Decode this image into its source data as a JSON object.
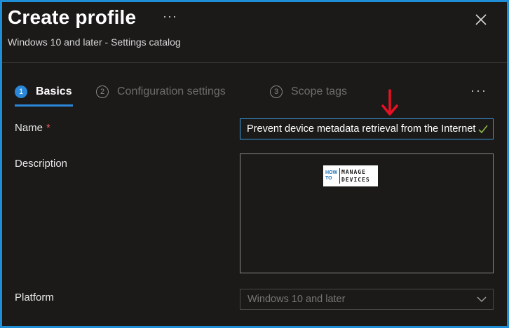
{
  "header": {
    "title": "Create profile",
    "more_label": "···",
    "subtitle": "Windows 10 and later - Settings catalog"
  },
  "steps": [
    {
      "number": "1",
      "label": "Basics",
      "active": true
    },
    {
      "number": "2",
      "label": "Configuration settings",
      "active": false
    },
    {
      "number": "3",
      "label": "Scope tags",
      "active": false
    }
  ],
  "steps_more_label": "···",
  "form": {
    "name_label": "Name",
    "required_marker": "*",
    "name_value": "Prevent device metadata retrieval from the Internet",
    "description_label": "Description",
    "description_value": "",
    "platform_label": "Platform",
    "platform_value": "Windows 10 and later"
  },
  "logo": {
    "how_to": "HOW TO",
    "line1": "MANAGE",
    "line2": "DEVICES"
  },
  "colors": {
    "accent": "#2b88d8",
    "frame_border": "#1e8fd6",
    "annotation_arrow": "#e81123",
    "valid_check": "#8fb84a"
  },
  "icons": {
    "close": "close-icon",
    "check": "check-icon",
    "chevron": "chevron-down-icon",
    "arrow": "red-down-arrow-annotation"
  }
}
